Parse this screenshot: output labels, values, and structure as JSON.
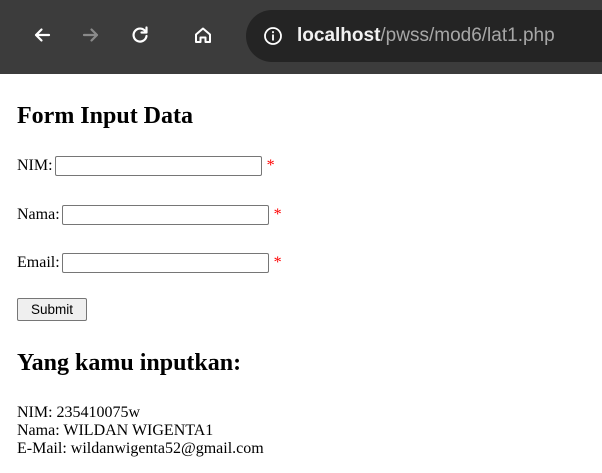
{
  "browser": {
    "url_host": "localhost",
    "url_path": "/pwss/mod6/lat1.php",
    "icons": [
      "back-icon",
      "forward-icon",
      "reload-icon",
      "home-icon",
      "info-icon"
    ]
  },
  "page": {
    "form_title": "Form Input Data",
    "fields": [
      {
        "label": "NIM:",
        "value": "",
        "required_mark": "*"
      },
      {
        "label": "Nama:",
        "value": "",
        "required_mark": "*"
      },
      {
        "label": "Email:",
        "value": "",
        "required_mark": "*"
      }
    ],
    "submit_label": "Submit",
    "result_title": "Yang kamu inputkan:",
    "results": [
      "NIM: 235410075w",
      "Nama: WILDAN WIGENTA1",
      "E-Mail: wildanwigenta52@gmail.com"
    ]
  },
  "colors": {
    "toolbar_bg": "#3c3c3c",
    "omnibox_bg": "#242424",
    "required": "#ff0000"
  }
}
